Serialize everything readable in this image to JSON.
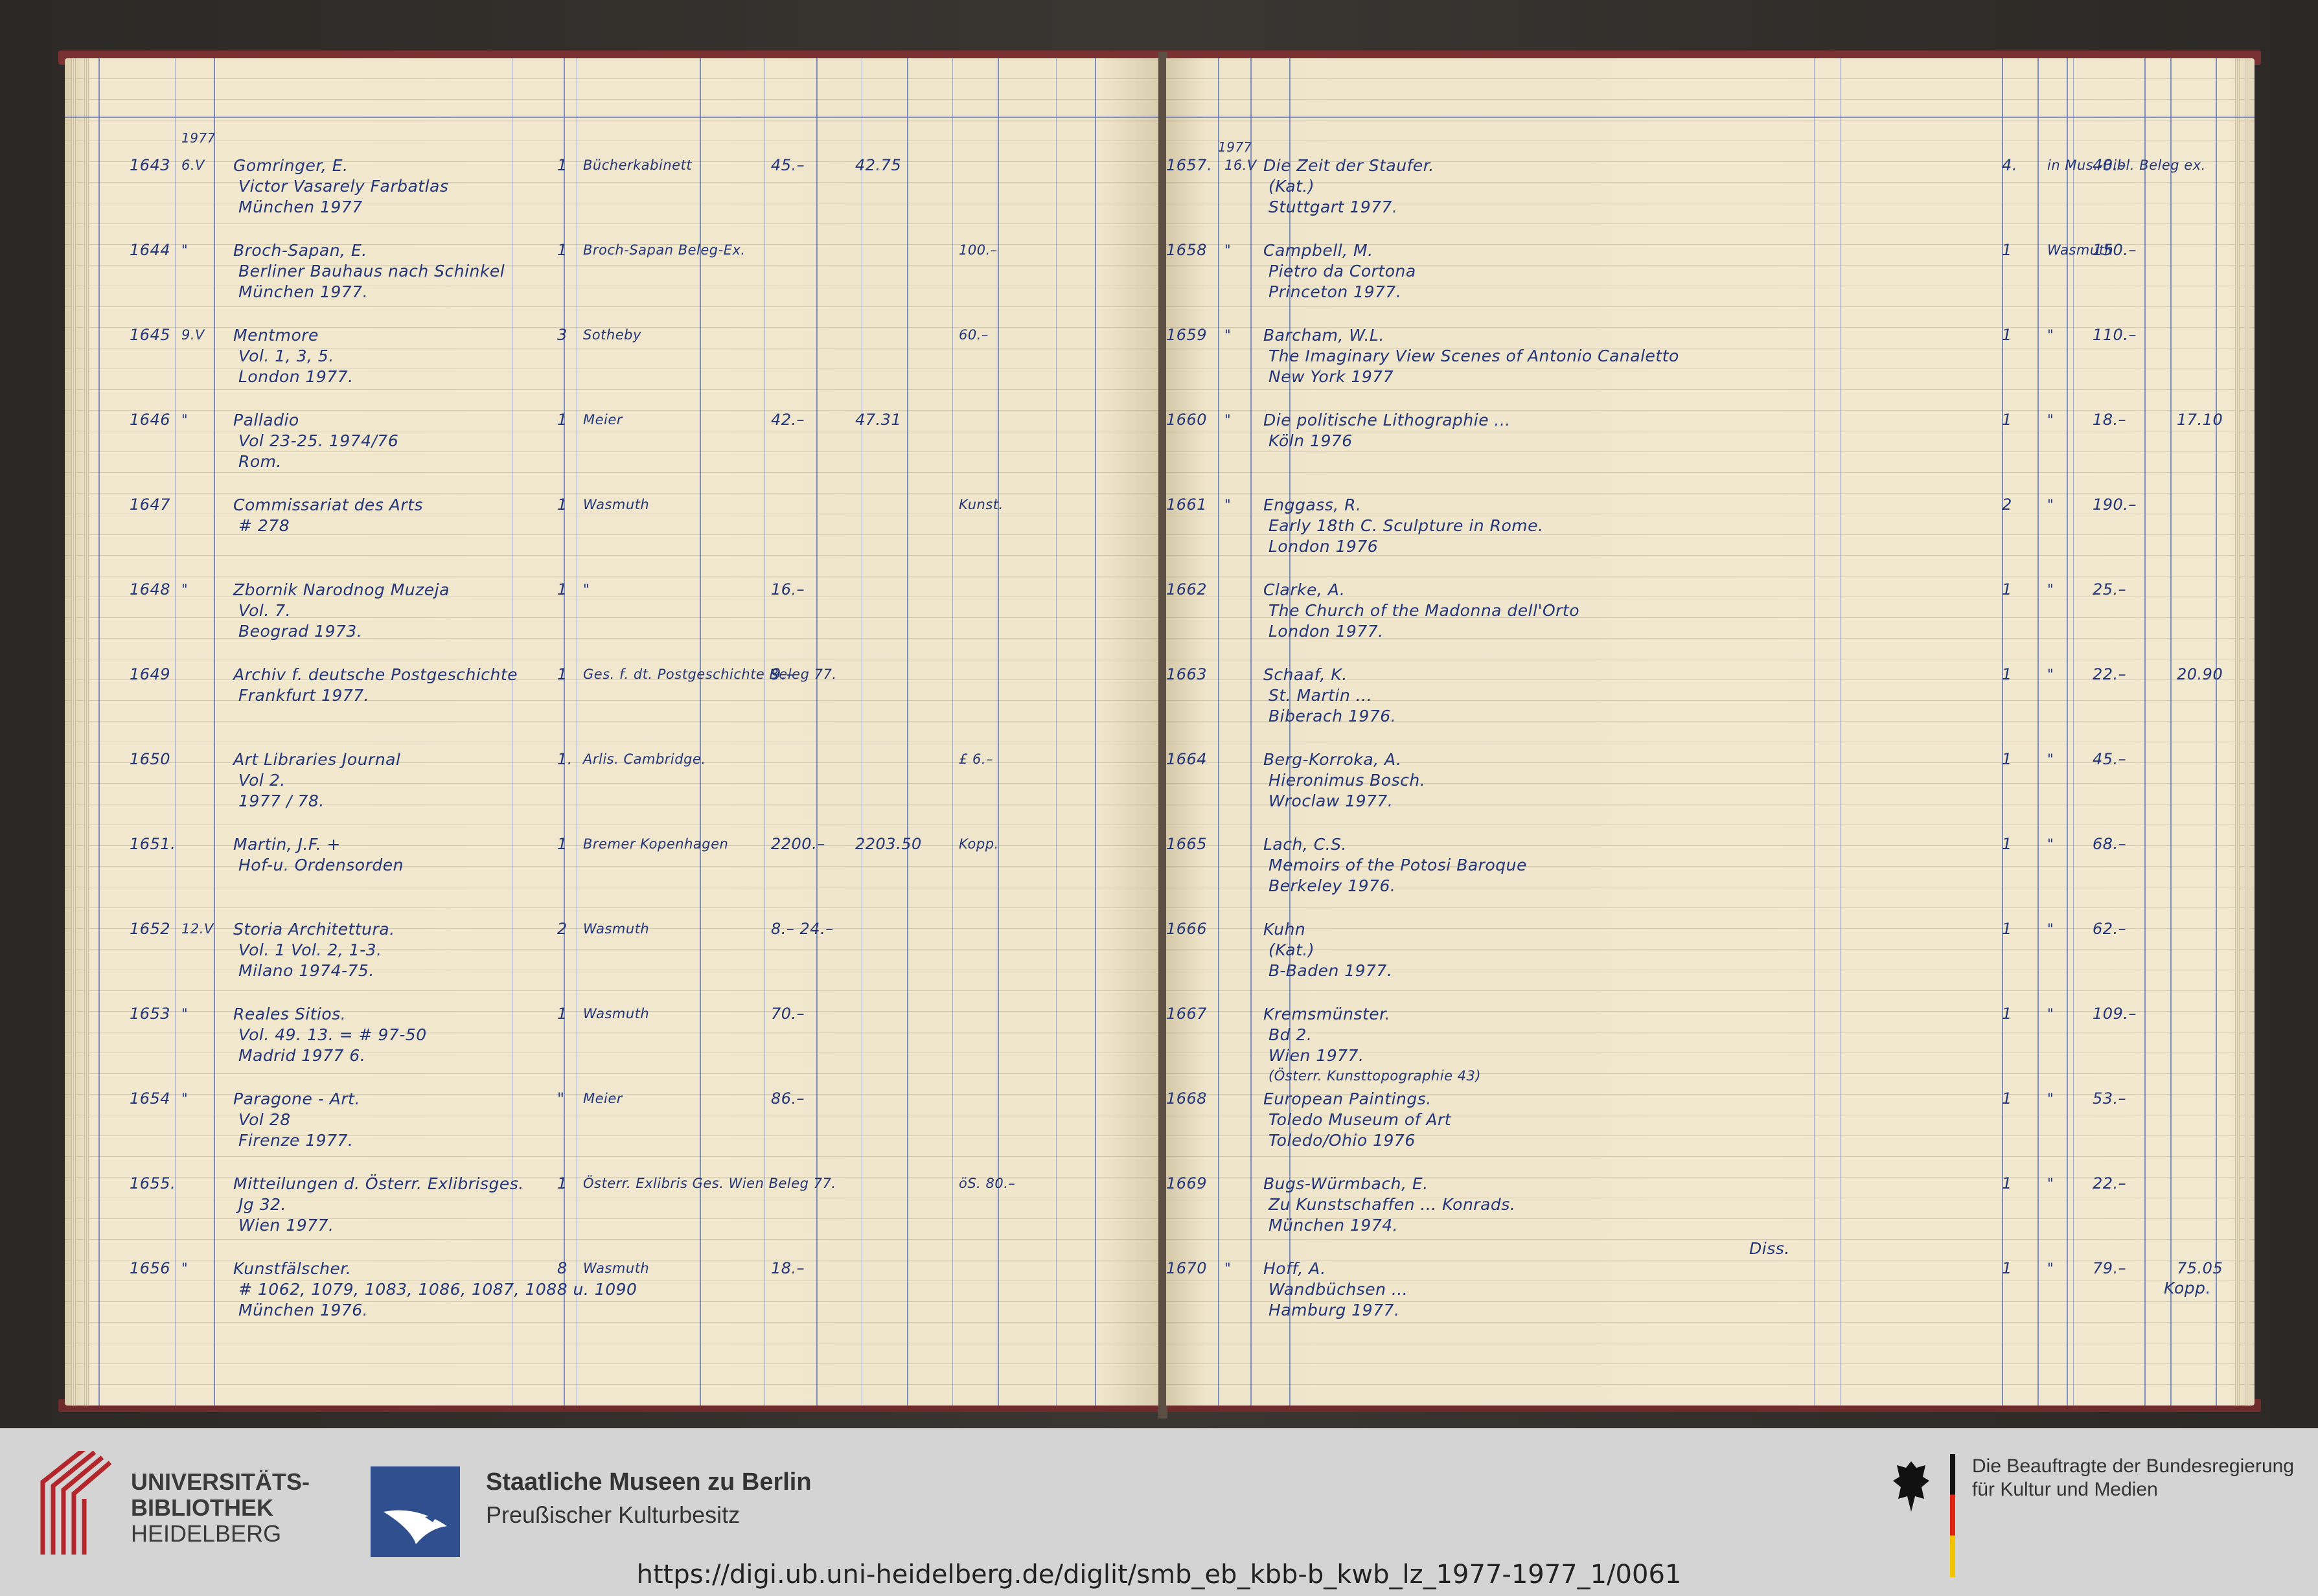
{
  "left_page": {
    "header_year": "1977",
    "rows": [
      {
        "no": "1643",
        "date": "6.V",
        "title": "Gomringer, E.",
        "sub1": "Victor Vasarely Farbatlas",
        "sub2": "München 1977",
        "qty": "1",
        "source": "Bücherkabinett",
        "price1": "45.–",
        "price2": "42.75",
        "note": ""
      },
      {
        "no": "1644",
        "date": "\"",
        "title": "Broch-Sapan, E.",
        "sub1": "Berliner Bauhaus nach Schinkel",
        "sub2": "München 1977.",
        "qty": "1",
        "source": "Broch-Sapan Beleg-Ex.",
        "price1": "",
        "price2": "",
        "note": "100.–"
      },
      {
        "no": "1645",
        "date": "9.V",
        "title": "Mentmore",
        "sub1": "Vol. 1, 3, 5.",
        "sub2": "London 1977.",
        "qty": "3",
        "source": "Sotheby",
        "price1": "",
        "price2": "",
        "note": "60.–"
      },
      {
        "no": "1646",
        "date": "\"",
        "title": "Palladio",
        "sub1": "Vol 23-25. 1974/76",
        "sub2": "Rom.",
        "qty": "1",
        "source": "Meier",
        "price1": "42.–",
        "price2": "47.31",
        "note": ""
      },
      {
        "no": "1647",
        "date": "",
        "title": "Commissariat des Arts",
        "sub1": "# 278",
        "sub2": "",
        "qty": "1",
        "source": "Wasmuth",
        "price1": "",
        "price2": "",
        "note": "Kunst."
      },
      {
        "no": "1648",
        "date": "\"",
        "title": "Zbornik Narodnog Muzeja",
        "sub1": "Vol. 7.",
        "sub2": "Beograd 1973.",
        "qty": "1",
        "source": "\"",
        "price1": "16.–",
        "price2": "",
        "note": ""
      },
      {
        "no": "1649",
        "date": "",
        "title": "Archiv f. deutsche Postgeschichte",
        "sub1": "Frankfurt 1977.",
        "sub2": "",
        "qty": "1",
        "source": "Ges. f. dt. Postgeschichte Beleg 77.",
        "price1": "9.–",
        "price2": "",
        "note": ""
      },
      {
        "no": "1650",
        "date": "",
        "title": "Art Libraries Journal",
        "sub1": "Vol 2.",
        "sub2": "1977 / 78.",
        "qty": "1.",
        "source": "Arlis. Cambridge.",
        "price1": "",
        "price2": "",
        "note": "£ 6.–"
      },
      {
        "no": "1651.",
        "date": "",
        "title": "Martin, J.F. +",
        "sub1": "Hof-u. Ordensorden",
        "sub2": "",
        "qty": "1",
        "source": "Bremer Kopenhagen",
        "price1": "2200.–",
        "price2": "2203.50",
        "note": "Kopp."
      },
      {
        "no": "1652",
        "date": "12.V",
        "title": "Storia Architettura.",
        "sub1": "Vol. 1   Vol. 2, 1-3.",
        "sub2": "Milano 1974-75.",
        "qty": "2",
        "source": "Wasmuth",
        "price1": "8.– 24.–",
        "price2": "",
        "note": ""
      },
      {
        "no": "1653",
        "date": "\"",
        "title": "Reales Sitios.",
        "sub1": "Vol. 49. 13. = # 97-50",
        "sub2": "Madrid 1977 6.",
        "qty": "1",
        "source": "Wasmuth",
        "price1": "70.–",
        "price2": "",
        "note": ""
      },
      {
        "no": "1654",
        "date": "\"",
        "title": "Paragone - Art.",
        "sub1": "Vol 28",
        "sub2": "Firenze 1977.",
        "qty": "\"",
        "source": "Meier",
        "price1": "86.–",
        "price2": "",
        "note": ""
      },
      {
        "no": "1655.",
        "date": "",
        "title": "Mitteilungen d. Österr. Exlibrisges.",
        "sub1": "Jg 32.",
        "sub2": "Wien 1977.",
        "qty": "1",
        "source": "Österr. Exlibris Ges. Wien Beleg 77.",
        "price1": "",
        "price2": "",
        "note": "öS. 80.–"
      },
      {
        "no": "1656",
        "date": "\"",
        "title": "Kunstfälscher.",
        "sub1": "# 1062, 1079, 1083, 1086, 1087, 1088 u. 1090",
        "sub2": "München 1976.",
        "qty": "8",
        "source": "Wasmuth",
        "price1": "18.–",
        "price2": "",
        "note": ""
      }
    ]
  },
  "right_page": {
    "header_year": "1977",
    "rows": [
      {
        "no": "1657.",
        "date": "16.V",
        "title": "Die Zeit der Staufer.",
        "sub1": "(Kat.)",
        "sub2": "Stuttgart 1977.",
        "qty": "4.",
        "source": "in Mus.-Bibl. Beleg ex.",
        "price1": "40.–",
        "price2": ""
      },
      {
        "no": "1658",
        "date": "\"",
        "title": "Campbell, M.",
        "sub1": "Pietro da Cortona",
        "sub2": "Princeton 1977.",
        "qty": "1",
        "source": "Wasmuth",
        "price1": "150.–",
        "price2": ""
      },
      {
        "no": "1659",
        "date": "\"",
        "title": "Barcham, W.L.",
        "sub1": "The Imaginary View Scenes of Antonio Canaletto",
        "sub2": "New York 1977",
        "qty": "1",
        "source": "\"",
        "price1": "110.–",
        "price2": ""
      },
      {
        "no": "1660",
        "date": "\"",
        "title": "Die politische Lithographie ...",
        "sub1": "Köln 1976",
        "sub2": "",
        "qty": "1",
        "source": "\"",
        "price1": "18.–",
        "price2": "17.10"
      },
      {
        "no": "1661",
        "date": "\"",
        "title": "Enggass, R.",
        "sub1": "Early 18th C. Sculpture in Rome.",
        "sub2": "London 1976",
        "qty": "2",
        "source": "\"",
        "price1": "190.–",
        "price2": ""
      },
      {
        "no": "1662",
        "date": "",
        "title": "Clarke, A.",
        "sub1": "The Church of the Madonna dell'Orto",
        "sub2": "London 1977.",
        "qty": "1",
        "source": "\"",
        "price1": "25.–",
        "price2": ""
      },
      {
        "no": "1663",
        "date": "",
        "title": "Schaaf, K.",
        "sub1": "St. Martin ...",
        "sub2": "Biberach 1976.",
        "qty": "1",
        "source": "\"",
        "price1": "22.–",
        "price2": "20.90"
      },
      {
        "no": "1664",
        "date": "",
        "title": "Berg-Korroka, A.",
        "sub1": "Hieronimus Bosch.",
        "sub2": "Wroclaw 1977.",
        "qty": "1",
        "source": "\"",
        "price1": "45.–",
        "price2": ""
      },
      {
        "no": "1665",
        "date": "",
        "title": "Lach, C.S.",
        "sub1": "Memoirs of the Potosi Baroque",
        "sub2": "Berkeley 1976.",
        "qty": "1",
        "source": "\"",
        "price1": "68.–",
        "price2": ""
      },
      {
        "no": "1666",
        "date": "",
        "title": "Kuhn",
        "sub1": "(Kat.)",
        "sub2": "B-Baden 1977.",
        "qty": "1",
        "source": "\"",
        "price1": "62.–",
        "price2": ""
      },
      {
        "no": "1667",
        "date": "",
        "title": "Kremsmünster.",
        "sub1": "Bd 2.",
        "sub2": "Wien 1977.",
        "sub3": "(Österr. Kunsttopographie 43)",
        "qty": "1",
        "source": "\"",
        "price1": "109.–",
        "price2": ""
      },
      {
        "no": "1668",
        "date": "",
        "title": "European Paintings.",
        "sub1": "Toledo Museum of Art",
        "sub2": "Toledo/Ohio 1976",
        "qty": "1",
        "source": "\"",
        "price1": "53.–",
        "price2": ""
      },
      {
        "no": "1669",
        "date": "",
        "title": "Bugs-Würmbach, E.",
        "sub1": "Zu Kunstschaffen ... Konrads.",
        "sub2": "München 1974.",
        "qty": "1",
        "source": "\"",
        "price1": "22.–",
        "price2": ""
      },
      {
        "no": "1670",
        "date": "\"",
        "title": "Hoff, A.",
        "sub1": "Wandbüchsen ...",
        "sub2": "Hamburg 1977.",
        "qty": "1",
        "source": "\"",
        "price1": "79.–",
        "price2": "75.05"
      }
    ],
    "extra_note": "Diss.",
    "signature_note": "Kopp."
  },
  "footer": {
    "ub_line1": "UNIVERSITÄTS-",
    "ub_line2": "BIBLIOTHEK",
    "ub_line3": "HEIDELBERG",
    "smb_title": "Staatliche Museen zu Berlin",
    "smb_sub": "Preußischer Kulturbesitz",
    "bkm_line1": "Die Beauftragte der Bundesregierung",
    "bkm_line2": "für Kultur und Medien",
    "url": "https://digi.ub.uni-heidelberg.de/diglit/smb_eb_kbb-b_kwb_lz_1977-1977_1/0061"
  },
  "colors": {
    "ink": "#24367a",
    "ruling": "#5c72b8",
    "paper": "#efe5cb",
    "cover": "#7a3131",
    "footer_bg": "#d4d4d4",
    "ub_red": "#b3262b",
    "smb_blue": "#2f4f8f"
  }
}
